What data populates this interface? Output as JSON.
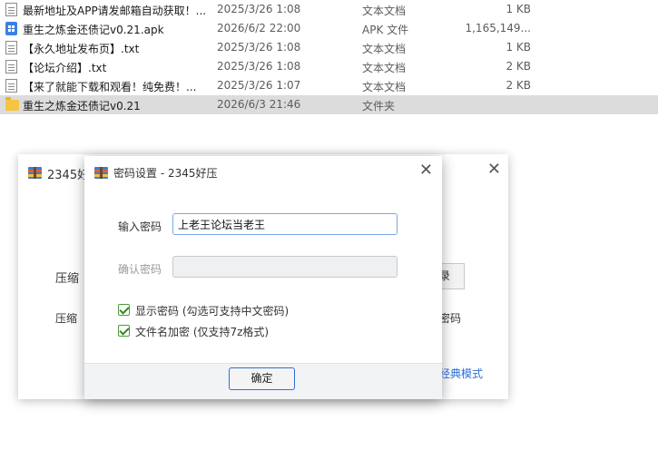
{
  "file_list": [
    {
      "name": "最新地址及APP请发邮箱自动获取！...",
      "date": "2025/3/26 1:08",
      "type": "文本文档",
      "size": "1 KB",
      "icon": "text-file-icon"
    },
    {
      "name": "重生之炼金还债记v0.21.apk",
      "date": "2026/6/2 22:00",
      "type": "APK 文件",
      "size": "1,165,149...",
      "icon": "apk-file-icon"
    },
    {
      "name": "【永久地址发布页】.txt",
      "date": "2025/3/26 1:08",
      "type": "文本文档",
      "size": "1 KB",
      "icon": "text-file-icon"
    },
    {
      "name": "【论坛介绍】.txt",
      "date": "2025/3/26 1:08",
      "type": "文本文档",
      "size": "2 KB",
      "icon": "text-file-icon"
    },
    {
      "name": "【来了就能下载和观看！纯免费！...",
      "date": "2025/3/26 1:07",
      "type": "文本文档",
      "size": "2 KB",
      "icon": "text-file-icon"
    },
    {
      "name": "重生之炼金还债记v0.21",
      "date": "2026/6/3 21:46",
      "type": "文件夹",
      "size": "",
      "icon": "folder-icon",
      "selected": true
    }
  ],
  "back_window": {
    "title": "2345好",
    "close": "✕",
    "label_compress": "压缩",
    "label_compress2": "压缩",
    "button_partial": "录",
    "text_partial": "密码",
    "link_classic": "经典模式"
  },
  "dialog": {
    "title": "密码设置 - 2345好压",
    "close": "✕",
    "label_password": "输入密码",
    "password_value": "上老王论坛当老王",
    "label_confirm": "确认密码",
    "show_password": "显示密码 (勾选可支持中文密码)",
    "show_password_checked": true,
    "encrypt_filenames": "文件名加密  (仅支持7z格式)",
    "encrypt_filenames_checked": true,
    "ok_button": "确定"
  },
  "colors": {
    "accent": "#2f6fd6",
    "check_green": "#2e8a1e",
    "selected_row": "#dcdcdc"
  }
}
